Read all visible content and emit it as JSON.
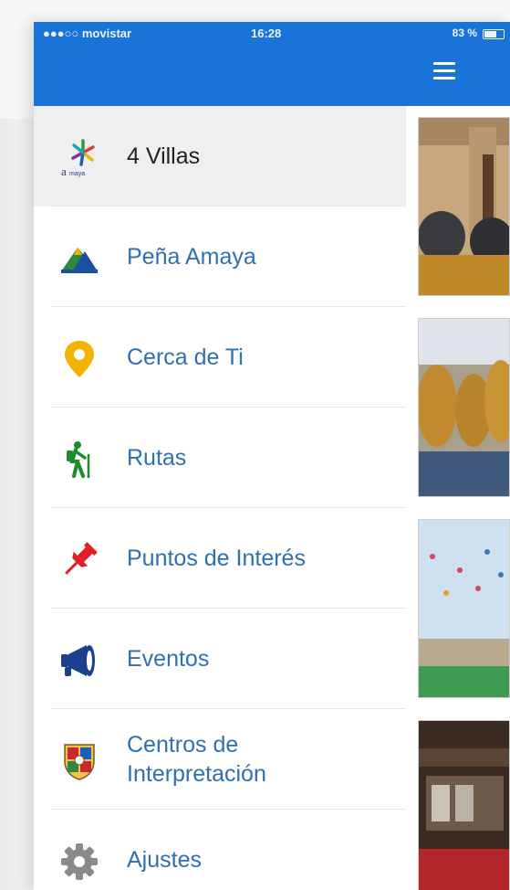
{
  "status_bar": {
    "carrier": "●●●○○ movistar",
    "time": "16:28",
    "battery": "83 %"
  },
  "menu": {
    "items": [
      {
        "label": "4 Villas",
        "icon": "amaya-logo-icon",
        "active": true
      },
      {
        "label": "Peña Amaya",
        "icon": "mountain-icon"
      },
      {
        "label": "Cerca de Ti",
        "icon": "location-pin-icon"
      },
      {
        "label": "Rutas",
        "icon": "hiker-icon"
      },
      {
        "label": "Puntos de Interés",
        "icon": "pushpin-icon"
      },
      {
        "label": "Eventos",
        "icon": "megaphone-icon"
      },
      {
        "label": "Centros de Interpretación",
        "icon": "coat-of-arms-icon"
      },
      {
        "label": "Ajustes",
        "icon": "gear-icon"
      }
    ]
  },
  "colors": {
    "topbar": "#1a73d8",
    "menu_text": "#2f6fb3",
    "active_bg": "#efefef"
  }
}
